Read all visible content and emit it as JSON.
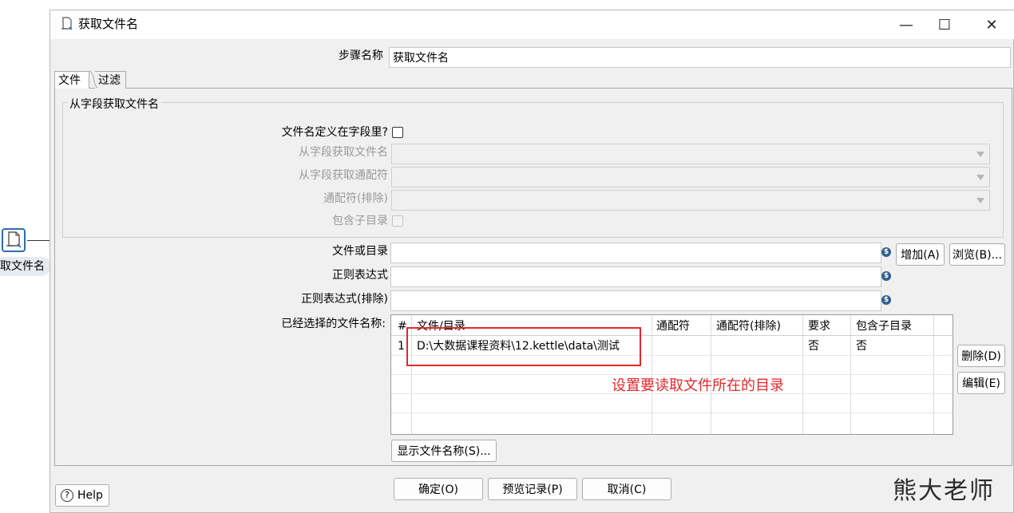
{
  "canvas": {
    "step_label": "取文件名"
  },
  "window": {
    "title": "获取文件名",
    "minimize": "—",
    "maximize": "☐",
    "close": "✕"
  },
  "step_name": {
    "label": "步骤名称",
    "value": "获取文件名"
  },
  "tabs": [
    {
      "label": "文件"
    },
    {
      "label": "过滤"
    }
  ],
  "from_field_group": {
    "title": "从字段获取文件名",
    "filename_in_field_label": "文件名定义在字段里?",
    "get_filename_from_field_label": "从字段获取文件名",
    "get_wildcard_from_field_label": "从字段获取通配符",
    "wildcard_exclude_label": "通配符(排除)",
    "include_subfolders_label": "包含子目录"
  },
  "file_or_dir": {
    "label": "文件或目录",
    "value": "",
    "add_button": "增加(A)",
    "browse_button": "浏览(B)..."
  },
  "regex": {
    "label": "正则表达式",
    "value": ""
  },
  "regex_exclude": {
    "label": "正则表达式(排除)",
    "value": ""
  },
  "selected_files": {
    "label": "已经选择的文件名称:",
    "columns": [
      "#",
      "文件/目录",
      "通配符",
      "通配符(排除)",
      "要求",
      "包含子目录"
    ],
    "rows": [
      {
        "num": "1",
        "file": "D:\\大数据课程资料\\12.kettle\\data\\测试",
        "wildcard": "",
        "wildcard_exclude": "",
        "required": "否",
        "include_subfolders": "否"
      }
    ],
    "delete_button": "删除(D)",
    "edit_button": "编辑(E)",
    "show_filenames_button": "显示文件名称(S)..."
  },
  "annotation": "设置要读取文件所在的目录",
  "footer": {
    "help_button": "Help",
    "ok_button": "确定(O)",
    "preview_button": "预览记录(P)",
    "cancel_button": "取消(C)"
  },
  "watermark": "熊大老师",
  "colors": {
    "annotation_red": "#e0292b",
    "icon_blue": "#2c6db4"
  }
}
